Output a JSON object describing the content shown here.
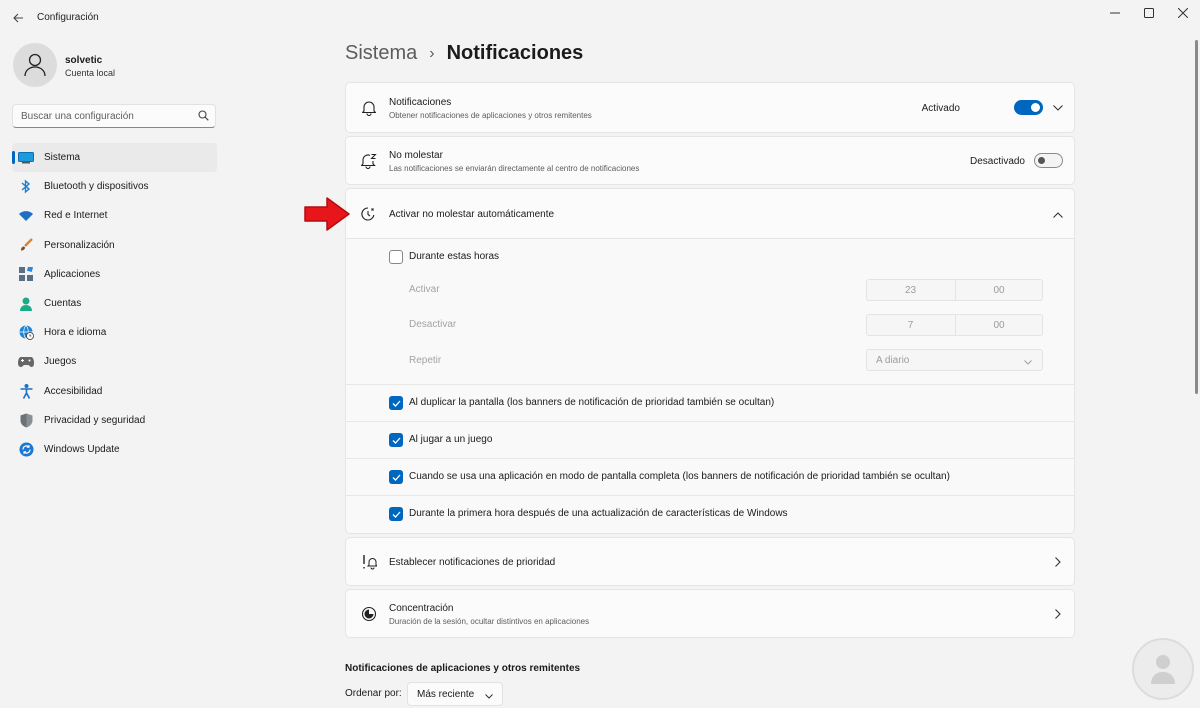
{
  "window": {
    "title": "Configuración"
  },
  "profile": {
    "name": "solvetic",
    "account_type": "Cuenta local"
  },
  "search": {
    "placeholder": "Buscar una configuración"
  },
  "sidebar": {
    "items": [
      {
        "label": "Sistema",
        "icon": "system-icon",
        "active": true
      },
      {
        "label": "Bluetooth y dispositivos",
        "icon": "bluetooth-icon"
      },
      {
        "label": "Red e Internet",
        "icon": "wifi-icon"
      },
      {
        "label": "Personalización",
        "icon": "brush-icon"
      },
      {
        "label": "Aplicaciones",
        "icon": "apps-icon"
      },
      {
        "label": "Cuentas",
        "icon": "person-icon"
      },
      {
        "label": "Hora e idioma",
        "icon": "globe-clock-icon"
      },
      {
        "label": "Juegos",
        "icon": "gamepad-icon"
      },
      {
        "label": "Accesibilidad",
        "icon": "accessibility-icon"
      },
      {
        "label": "Privacidad y seguridad",
        "icon": "shield-icon"
      },
      {
        "label": "Windows Update",
        "icon": "update-icon"
      }
    ]
  },
  "breadcrumb": {
    "parent": "Sistema",
    "separator": "›",
    "current": "Notificaciones"
  },
  "notifications_card": {
    "title": "Notificaciones",
    "subtitle": "Obtener notificaciones de aplicaciones y otros remitentes",
    "toggle_label": "Activado",
    "toggle_on": true
  },
  "dnd_card": {
    "title": "No molestar",
    "subtitle": "Las notificaciones se enviarán directamente al centro de notificaciones",
    "toggle_label": "Desactivado",
    "toggle_on": false
  },
  "auto_dnd": {
    "title": "Activar no molestar automáticamente",
    "during_hours": {
      "label": "Durante estas horas",
      "checked": false
    },
    "activate": {
      "label": "Activar",
      "hour": "23",
      "minute": "00"
    },
    "deactivate": {
      "label": "Desactivar",
      "hour": "7",
      "minute": "00"
    },
    "repeat": {
      "label": "Repetir",
      "value": "A diario"
    },
    "options": [
      {
        "label": "Al duplicar la pantalla (los banners de notificación de prioridad también se ocultan)",
        "checked": true
      },
      {
        "label": "Al jugar a un juego",
        "checked": true
      },
      {
        "label": "Cuando se usa una aplicación en modo de pantalla completa (los banners de notificación de prioridad también se ocultan)",
        "checked": true
      },
      {
        "label": "Durante la primera hora después de una actualización de características de Windows",
        "checked": true
      }
    ]
  },
  "priority_card": {
    "title": "Establecer notificaciones de prioridad"
  },
  "focus_card": {
    "title": "Concentración",
    "subtitle": "Duración de la sesión, ocultar distintivos en aplicaciones"
  },
  "apps_section": {
    "title": "Notificaciones de aplicaciones y otros remitentes",
    "sort_label": "Ordenar por:",
    "sort_value": "Más reciente"
  },
  "colors": {
    "accent": "#0067c0",
    "annotation_arrow": "#e8151b"
  }
}
